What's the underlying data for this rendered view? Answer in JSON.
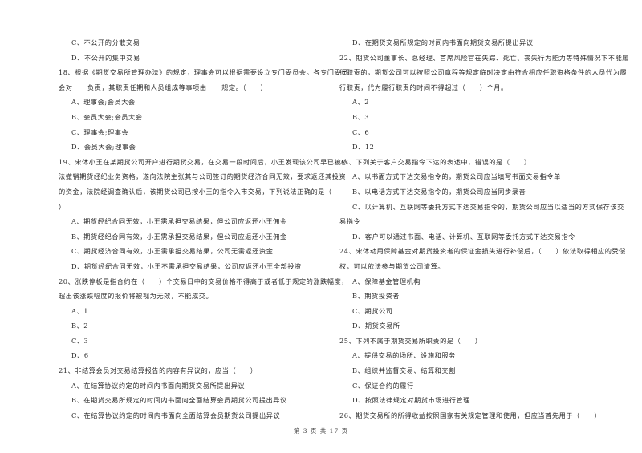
{
  "page": {
    "footer": "第 3 页 共 17 页"
  },
  "left_column": [
    {
      "type": "opt",
      "text": "C、不公开的分散交易"
    },
    {
      "type": "opt",
      "text": "D、不公开的集中交易"
    },
    {
      "type": "q",
      "text": "18、根据《期货交易所管理办法》的规定，理事会可以根据需要设立专门委员会。各专门委员"
    },
    {
      "type": "cont",
      "text": "会对____负责，其职责任期和人员组成等事项由____规定。（　　）"
    },
    {
      "type": "opt",
      "text": "A、理事会;会员大会"
    },
    {
      "type": "opt",
      "text": "B、会员大会;会员大会"
    },
    {
      "type": "opt",
      "text": "C、理事会;理事会"
    },
    {
      "type": "opt",
      "text": "D、会员大会;理事会"
    },
    {
      "type": "q",
      "text": "19、宋体小王在某期货公司开户进行期货交易，在交易一段时间后，小王发现该公司早已被依"
    },
    {
      "type": "cont",
      "text": "法撤销期货经纪业务资格，遂向法院主张其与公司签订的期货经济合同无效，要求返还其投资"
    },
    {
      "type": "cont",
      "text": "的资金，法院经调查确认后，该期货公司已按小王的指令入市交易，下列说法正确的是（"
    },
    {
      "type": "cont",
      "text": "）"
    },
    {
      "type": "opt",
      "text": "A、期货经纪合同无效，小王需承担交易结果，但公司应返还小王佣金"
    },
    {
      "type": "opt",
      "text": "B、期货经纪合同有效，小王需承担交易结果，但公司应返还小王佣金"
    },
    {
      "type": "opt",
      "text": "C、期货经济合同有效，小王需承担交易结果，公司无需返还资金"
    },
    {
      "type": "opt",
      "text": "D、期货经纪合同无效，小王不需承担交易结果，公司应返还小王全部投资"
    },
    {
      "type": "q",
      "text": "20、涨跌停板是指合约在（　　）个交易日中的交易价格不得高于或者低于规定的涨跌幅度，"
    },
    {
      "type": "cont",
      "text": "超出该涨跌幅度的报价将被视为无效，不能成交。"
    },
    {
      "type": "opt",
      "text": "A、1"
    },
    {
      "type": "opt",
      "text": "B、2"
    },
    {
      "type": "opt",
      "text": "C、3"
    },
    {
      "type": "opt",
      "text": "D、6"
    },
    {
      "type": "q",
      "text": "21、非结算会员对交易结算报告的内容有异议的，应当（　　）"
    },
    {
      "type": "opt",
      "text": "A、在结算协议约定的时间内书面向期货交易所提出异议"
    },
    {
      "type": "opt",
      "text": "B、在期货交易所规定的时间内书面向全面结算会员期货公司提出异议"
    },
    {
      "type": "opt",
      "text": "C、在结算协议约定的时间内书面向全面结算会员期货公司提出异议"
    }
  ],
  "right_column": [
    {
      "type": "opt",
      "text": "D、在期货交易所规定的时间内书面向期货交易所提出异议"
    },
    {
      "type": "q",
      "text": "22、期货公司董事长、总经理、首席风险官在失踪、死亡、丧失行为能力等特殊情况下不能履"
    },
    {
      "type": "cont",
      "text": "行职责的，期货公司可以按照公司章程等规定临时决定由符合相应任职资格条件的人员代为履"
    },
    {
      "type": "cont",
      "text": "行职责，代为履行职责的时间不得超过（　　）个月。"
    },
    {
      "type": "opt",
      "text": "A、2"
    },
    {
      "type": "opt",
      "text": "B、3"
    },
    {
      "type": "opt",
      "text": "C、6"
    },
    {
      "type": "opt",
      "text": "D、12"
    },
    {
      "type": "q",
      "text": "23、下列关于客户交易指令下达的表述中，错误的是（　　）"
    },
    {
      "type": "opt",
      "text": "A、以书面方式下达交易指令的，期货公司应当填写书面交易指令单"
    },
    {
      "type": "opt",
      "text": "B、以电话方式下达交易指令的，期货公司应当同步录音"
    },
    {
      "type": "opt",
      "text": "C、以计算机、互联网等委托方式下达交易指令的，期货公司应当以适当的方式保存该交"
    },
    {
      "type": "cont",
      "text": "易指令"
    },
    {
      "type": "opt",
      "text": "D、客户可以通过书面、电话、计算机、互联网等委托方式下达交易指令"
    },
    {
      "type": "q",
      "text": "24、宋体动用保障基金对期货投资者的保证金损失进行补偿后，（　　）依法取得相应的受偿"
    },
    {
      "type": "cont",
      "text": "权，可以依法参与期货公司清算。"
    },
    {
      "type": "opt",
      "text": "A、保障基金管理机构"
    },
    {
      "type": "opt",
      "text": "B、期货投资者"
    },
    {
      "type": "opt",
      "text": "C、期货公司"
    },
    {
      "type": "opt",
      "text": "D、期货交易所"
    },
    {
      "type": "q",
      "text": "25、下列不属于期货交易所职责的是（　　）"
    },
    {
      "type": "opt",
      "text": "A、提供交易的场所、设施和服务"
    },
    {
      "type": "opt",
      "text": "B、组织并监督交易、结算和交割"
    },
    {
      "type": "opt",
      "text": "C、保证合约的履行"
    },
    {
      "type": "opt",
      "text": "D、按照法律规定对期货市场进行管理"
    },
    {
      "type": "q",
      "text": "26、期货交易所的所得收益按照国家有关规定管理和使用，但应当首先用于（　　）"
    }
  ]
}
